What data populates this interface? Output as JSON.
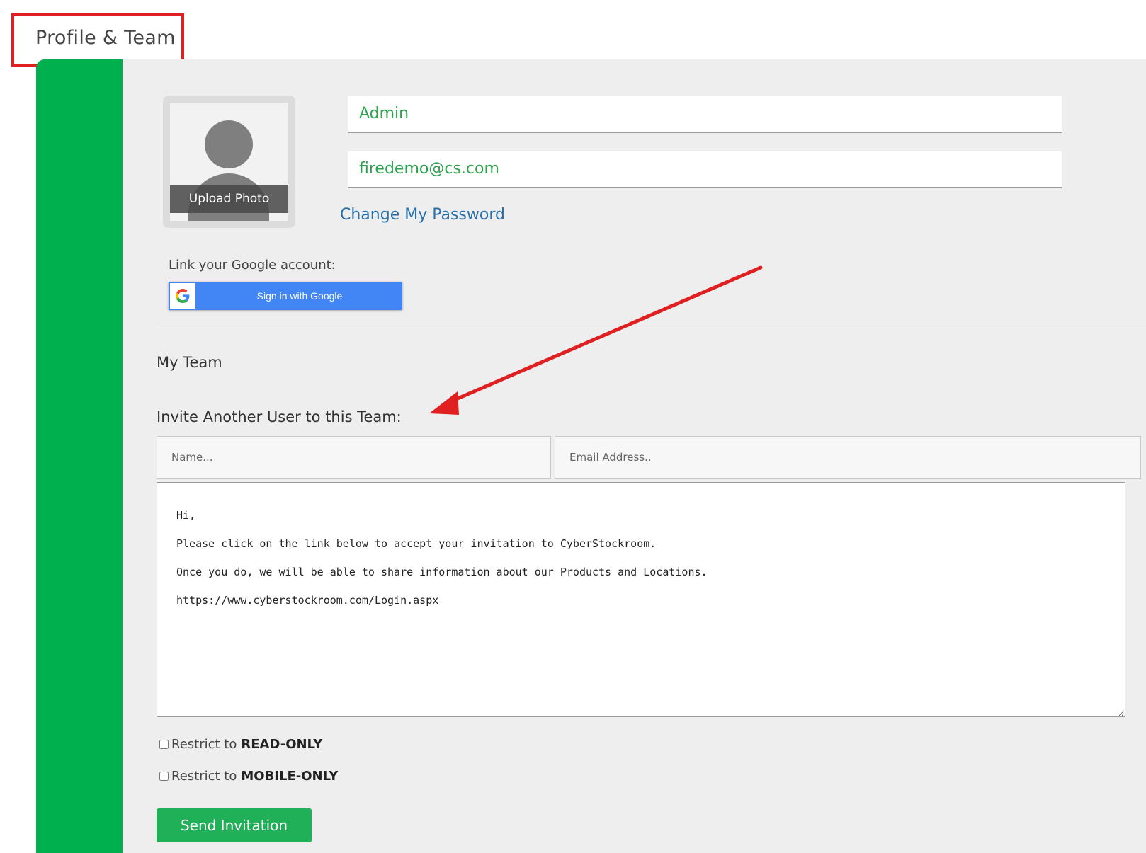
{
  "page": {
    "title": "Profile & Team"
  },
  "profile": {
    "upload_photo_label": "Upload Photo",
    "name_value": "Admin",
    "email_value": "firedemo@cs.com",
    "change_password_label": "Change My Password"
  },
  "google": {
    "link_label": "Link your Google account:",
    "button_label": "Sign in with Google"
  },
  "team": {
    "heading": "My Team",
    "invite_heading": "Invite Another User to this Team:",
    "name_placeholder": "Name...",
    "email_placeholder": "Email Address..",
    "message": "Hi,\nPlease click on the link below to accept your invitation to CyberStockroom.\nOnce you do, we will be able to share information about our Products and Locations.\nhttps://www.cyberstockroom.com/Login.aspx",
    "readonly_prefix": "Restrict to",
    "readonly_value": "READ-ONLY",
    "mobile_prefix": "Restrict to",
    "mobile_value": "MOBILE-ONLY",
    "send_label": "Send Invitation"
  },
  "colors": {
    "sidebar_green": "#00b04f",
    "field_text_green": "#2ea44f",
    "link_blue": "#2a6fa8",
    "google_blue": "#4285f4",
    "annotation_red": "#e02020"
  },
  "icons": {
    "avatar": "avatar-icon",
    "google_logo": "google-logo-icon"
  }
}
